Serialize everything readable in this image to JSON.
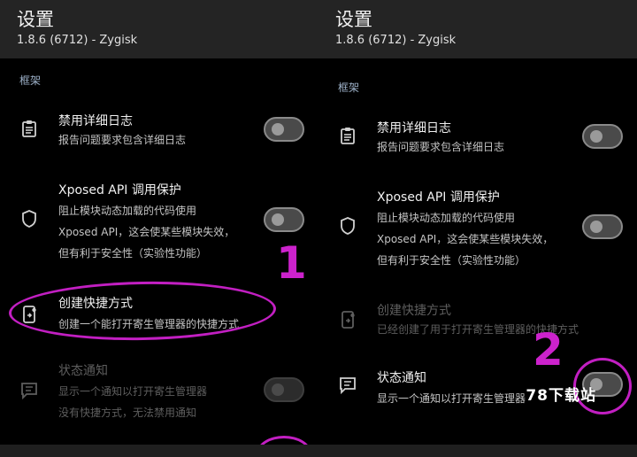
{
  "left": {
    "title": "设置",
    "subtitle": "1.8.6 (6712) - Zygisk",
    "section": "框架",
    "rows": [
      {
        "title": "禁用详细日志",
        "desc": [
          "报告问题要求包含详细日志"
        ]
      },
      {
        "title": "Xposed API 调用保护",
        "desc": [
          "阻止模块动态加载的代码使用",
          "Xposed API，这会使某些模块失效，",
          "但有利于安全性（实验性功能）"
        ]
      },
      {
        "title": "创建快捷方式",
        "desc": [
          "创建一个能打开寄生管理器的快捷方式"
        ]
      },
      {
        "title": "状态通知",
        "desc": [
          "显示一个通知以打开寄生管理器",
          "没有快捷方式，无法禁用通知"
        ]
      }
    ]
  },
  "right": {
    "title": "设置",
    "subtitle": "1.8.6 (6712) - Zygisk",
    "section": "框架",
    "rows": [
      {
        "title": "禁用详细日志",
        "desc": [
          "报告问题要求包含详细日志"
        ]
      },
      {
        "title": "Xposed API 调用保护",
        "desc": [
          "阻止模块动态加载的代码使用",
          "Xposed API，这会使某些模块失效，",
          "但有利于安全性（实验性功能）"
        ]
      },
      {
        "title": "创建快捷方式",
        "desc": [
          "已经创建了用于打开寄生管理器的快捷方式"
        ]
      },
      {
        "title": "状态通知",
        "desc": [
          "显示一个通知以打开寄生管理器"
        ]
      }
    ]
  },
  "annotations": {
    "step1": "1",
    "step2": "2"
  },
  "watermark": "78下载站",
  "colors": {
    "annotation": "#c21fc2",
    "section_title": "#9db1c8",
    "header_bg": "#242424"
  },
  "icons": [
    "clipboard-icon",
    "shield-icon",
    "shortcut-icon",
    "notification-icon"
  ]
}
